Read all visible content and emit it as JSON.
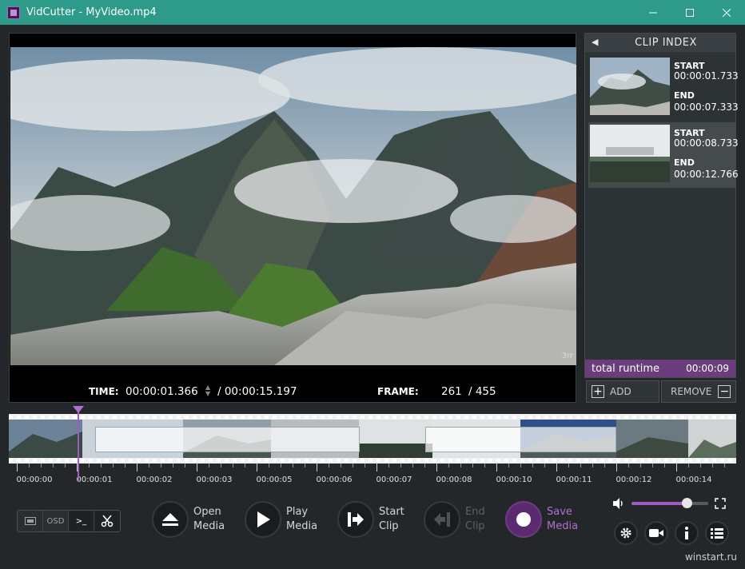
{
  "window": {
    "title": "VidCutter - MyVideo.mp4",
    "controls": [
      "minimize-icon",
      "maximize-icon",
      "close-icon"
    ]
  },
  "player": {
    "time_label": "TIME:",
    "current_time": "00:00:01.366",
    "total_time": "/ 00:00:15.197",
    "frame_label": "FRAME:",
    "current_frame": "261",
    "total_frames": "/ 455",
    "overlay_text": "3rr"
  },
  "clip_index": {
    "header": "CLIP INDEX",
    "clips": [
      {
        "start_label": "START",
        "start": "00:00:01.733",
        "end_label": "END",
        "end": "00:00:07.333",
        "selected": false
      },
      {
        "start_label": "START",
        "start": "00:00:08.733",
        "end_label": "END",
        "end": "00:00:12.766",
        "selected": true
      }
    ],
    "runtime_label": "total runtime",
    "runtime_value": "00:00:09",
    "add_label": "ADD",
    "remove_label": "REMOVE"
  },
  "timeline": {
    "ticks": [
      "00:00:00",
      "00:00:01",
      "00:00:02",
      "00:00:03",
      "00:00:05",
      "00:00:06",
      "00:00:07",
      "00:00:08",
      "00:00:10",
      "00:00:11",
      "00:00:12",
      "00:00:14"
    ],
    "playhead_time": "00:00:01.366"
  },
  "toolbar": {
    "modes": [
      {
        "name": "mode-thumbnails",
        "label": "",
        "icon": "film-icon"
      },
      {
        "name": "mode-osd",
        "label": "OSD",
        "icon": ""
      },
      {
        "name": "mode-console",
        "label": ">_",
        "icon": "console-icon"
      },
      {
        "name": "mode-smartcut",
        "label": "",
        "icon": "scissors-icon"
      }
    ],
    "open_media": [
      "Open",
      "Media"
    ],
    "play_media": [
      "Play",
      "Media"
    ],
    "start_clip": [
      "Start",
      "Clip"
    ],
    "end_clip": [
      "End",
      "Clip"
    ],
    "save_media": [
      "Save",
      "Media"
    ],
    "volume": 0.72,
    "accent": "#a05cc0"
  },
  "watermark": "winstart.ru"
}
